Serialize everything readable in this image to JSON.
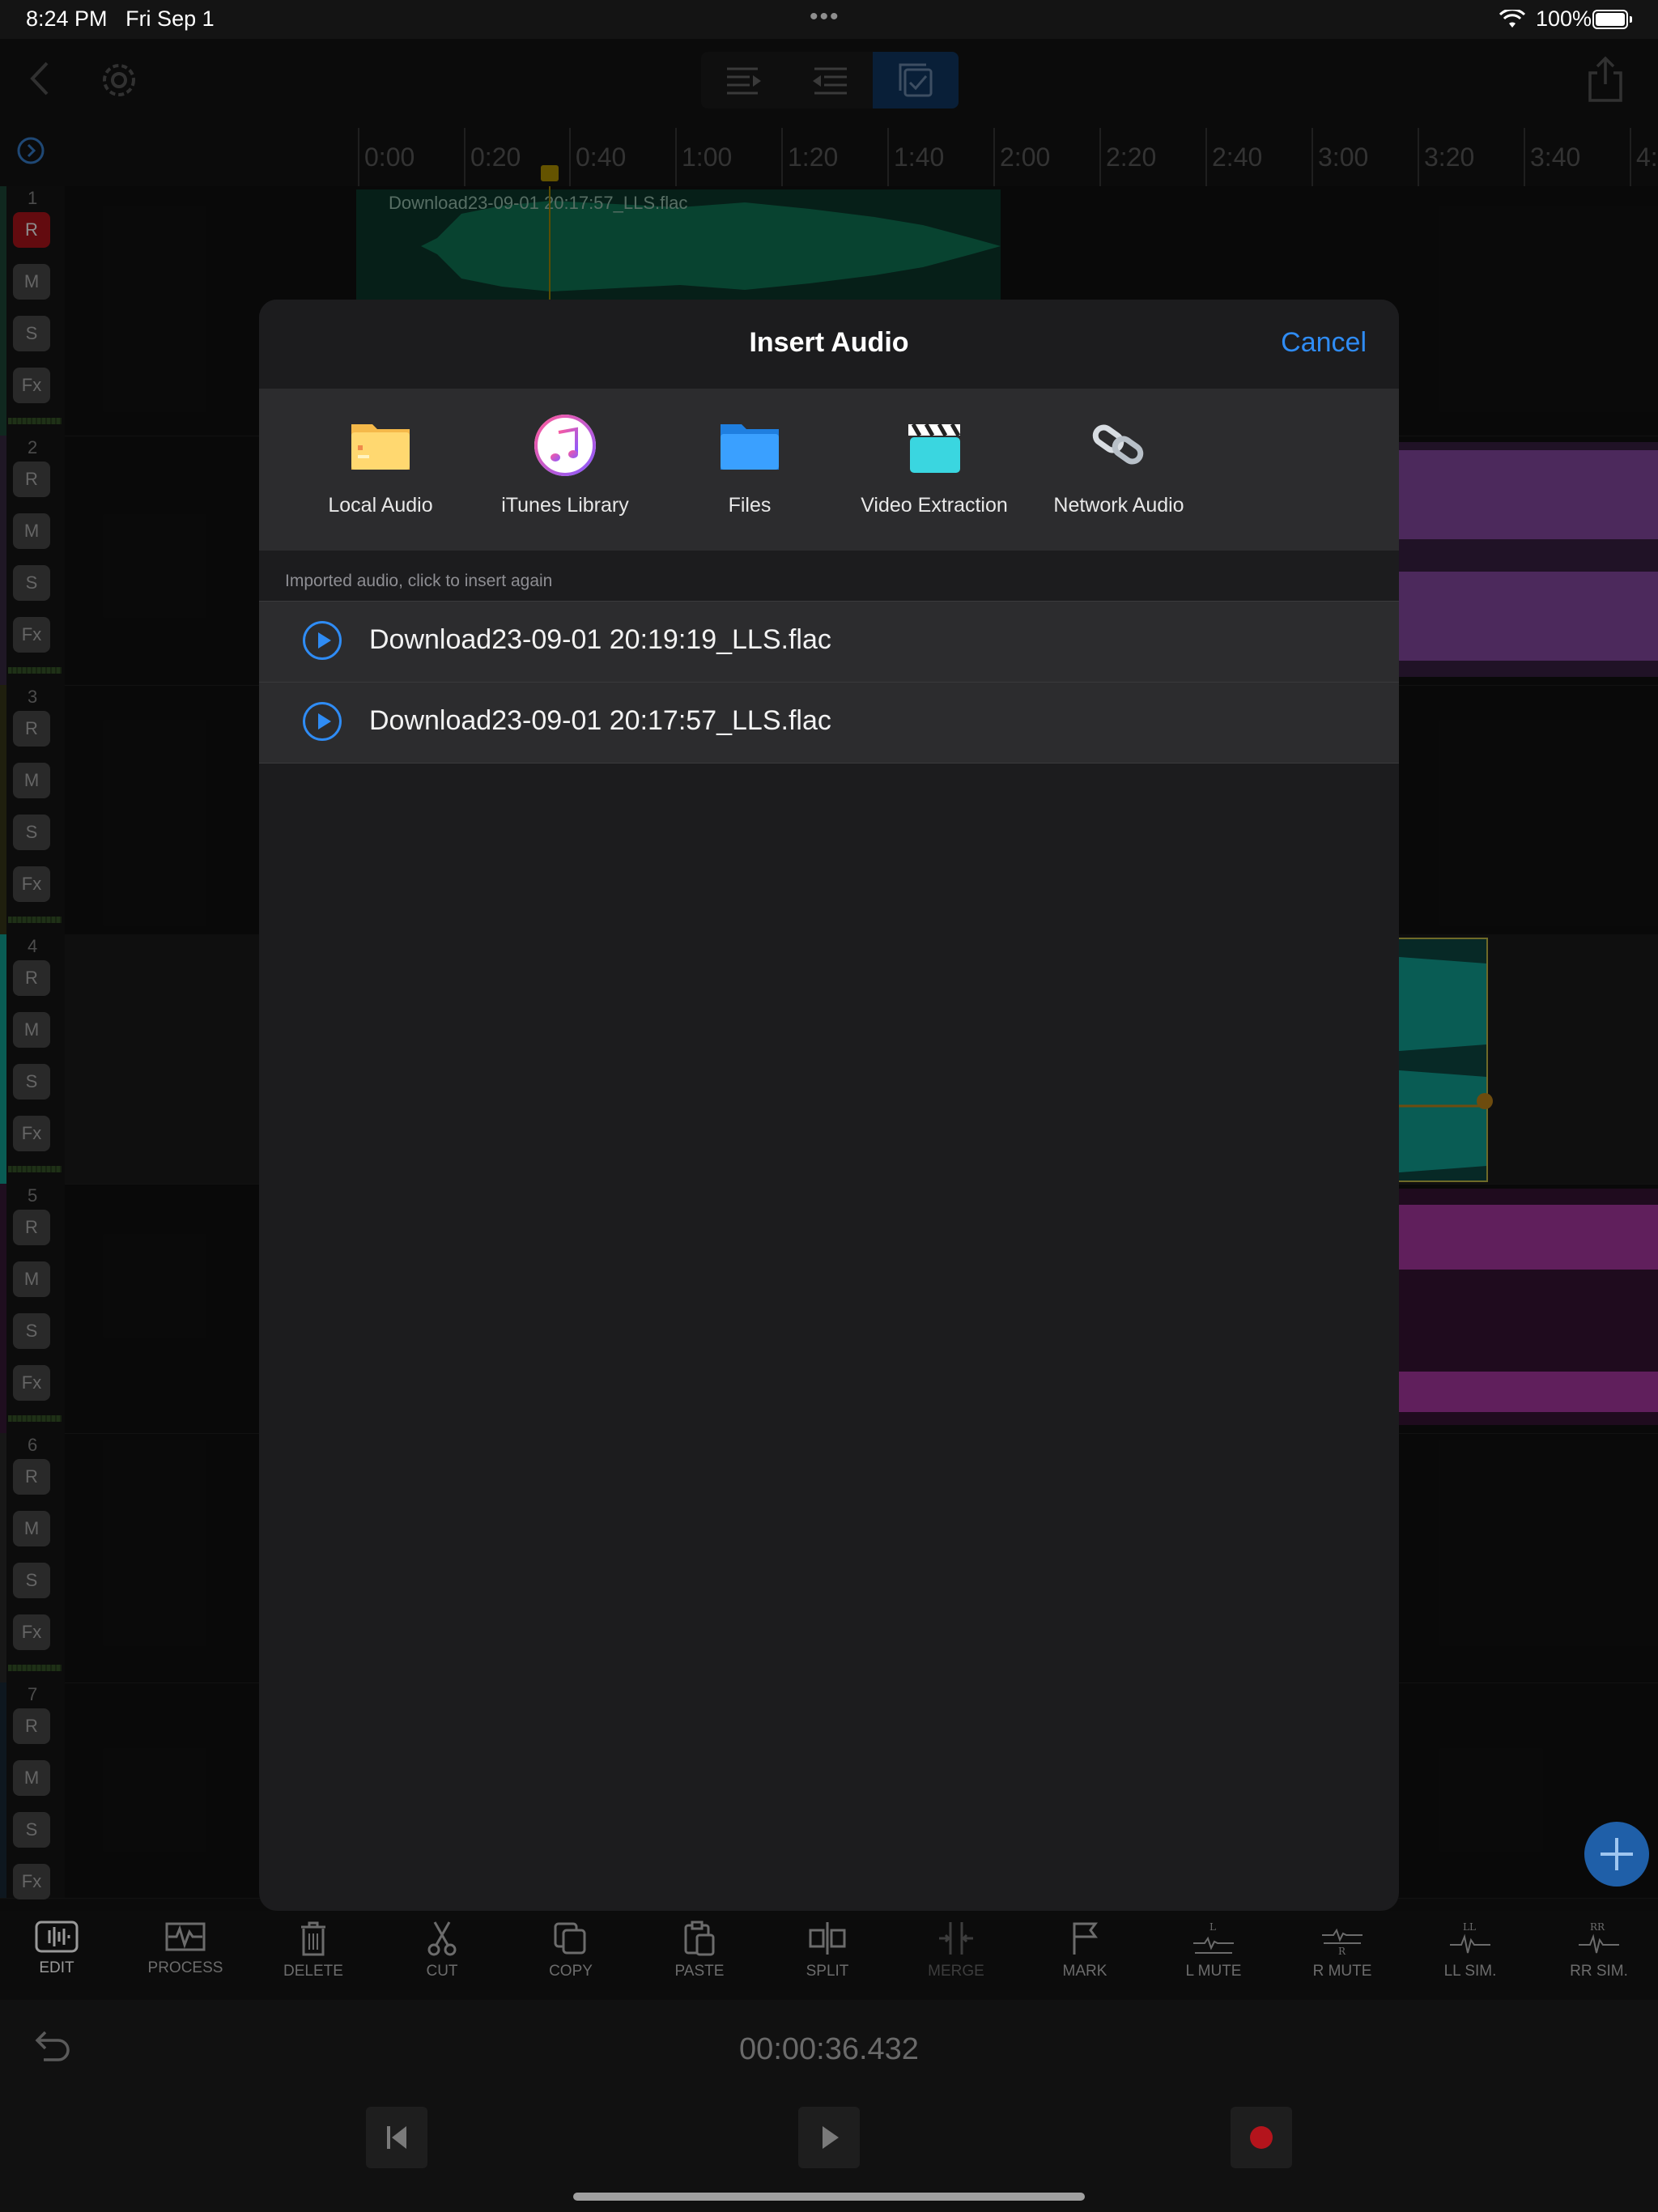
{
  "status": {
    "time": "8:24 PM",
    "date": "Fri Sep 1",
    "battery": "100%"
  },
  "ruler": {
    "labels": [
      "0:00",
      "0:20",
      "0:40",
      "1:00",
      "1:20",
      "1:40",
      "2:00",
      "2:20",
      "2:40",
      "3:00",
      "3:20",
      "3:40",
      "4:"
    ]
  },
  "tracks": [
    {
      "number": "1",
      "r": "R",
      "m": "M",
      "s": "S",
      "fx": "Fx"
    },
    {
      "number": "2",
      "r": "R",
      "m": "M",
      "s": "S",
      "fx": "Fx"
    },
    {
      "number": "3",
      "r": "R",
      "m": "M",
      "s": "S",
      "fx": "Fx"
    },
    {
      "number": "4",
      "r": "R",
      "m": "M",
      "s": "S",
      "fx": "Fx"
    },
    {
      "number": "5",
      "r": "R",
      "m": "M",
      "s": "S",
      "fx": "Fx"
    },
    {
      "number": "6",
      "r": "R",
      "m": "M",
      "s": "S",
      "fx": "Fx"
    },
    {
      "number": "7",
      "r": "R",
      "m": "M",
      "s": "S",
      "fx": "Fx"
    }
  ],
  "clip1": {
    "name": "Download23-09-01 20:17:57_LLS.flac"
  },
  "modal": {
    "title": "Insert Audio",
    "cancel": "Cancel",
    "sources": [
      "Local Audio",
      "iTunes Library",
      "Files",
      "Video Extraction",
      "Network Audio"
    ],
    "section_note": "Imported audio, click to insert again",
    "files": [
      "Download23-09-01 20:19:19_LLS.flac",
      "Download23-09-01 20:17:57_LLS.flac"
    ]
  },
  "tools": [
    "EDIT",
    "PROCESS",
    "DELETE",
    "CUT",
    "COPY",
    "PASTE",
    "SPLIT",
    "MERGE",
    "MARK",
    "L MUTE",
    "R MUTE",
    "LL SIM.",
    "RR SIM."
  ],
  "transport": {
    "timecode": "00:00:36.432"
  },
  "colors": {
    "accent": "#2f8cf5",
    "record": "#b4141c",
    "clip_green": "#0e6b4e",
    "clip_purple": "#8a4ba8",
    "clip_teal": "#12a89a",
    "clip_magenta": "#b03aa8"
  }
}
